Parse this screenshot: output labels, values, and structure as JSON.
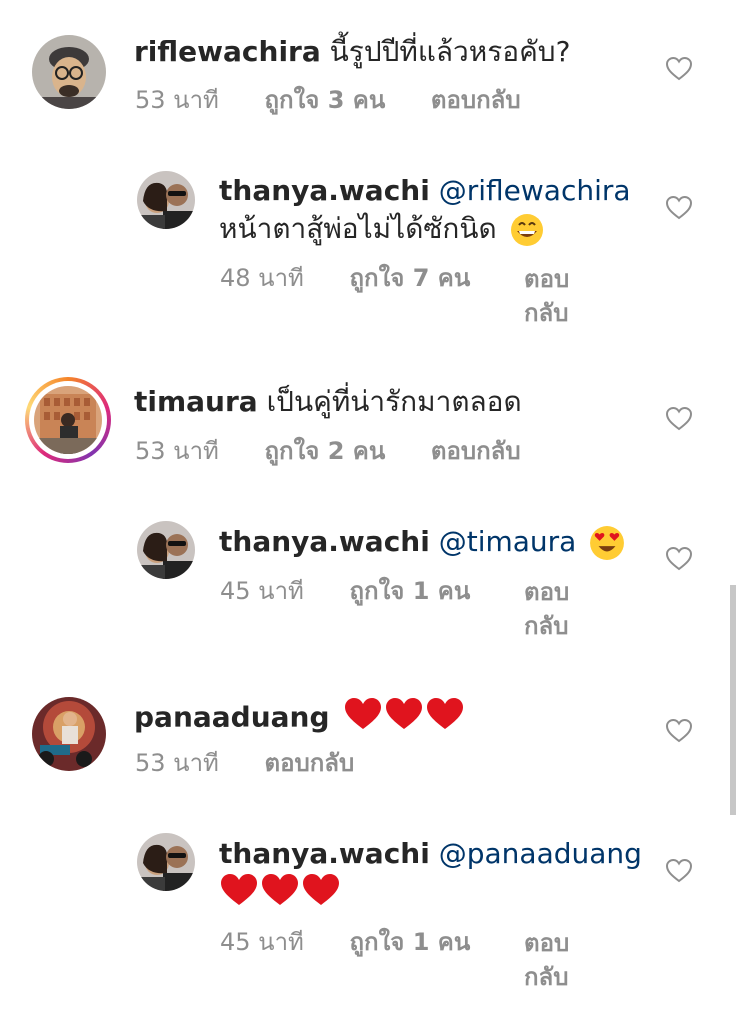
{
  "comments": [
    {
      "username": "riflewachira",
      "text": "นี้รูปปีที่แล้วหรอคับ?",
      "time": "53 นาที",
      "likes": "ถูกใจ 3 คน",
      "reply": "ตอบกลับ"
    },
    {
      "username": "thanya.wachi",
      "mention": "@riflewachira",
      "text": "หน้าตาสู้พ่อไม่ได้ซักนิด",
      "emoji": "grinning-face-emoji",
      "time": "48 นาที",
      "likes": "ถูกใจ 7 คน",
      "reply": "ตอบกลับ"
    },
    {
      "username": "timaura",
      "text": "เป็นคู่ที่น่ารักมาตลอด",
      "time": "53 นาที",
      "likes": "ถูกใจ 2 คน",
      "reply": "ตอบกลับ"
    },
    {
      "username": "thanya.wachi",
      "mention": "@timaura",
      "emoji": "heart-eyes-emoji",
      "time": "45 นาที",
      "likes": "ถูกใจ 1 คน",
      "reply": "ตอบกลับ"
    },
    {
      "username": "panaaduang",
      "emoji": "red-hearts-emoji",
      "time": "53 นาที",
      "reply": "ตอบกลับ"
    },
    {
      "username": "thanya.wachi",
      "mention": "@panaaduang",
      "emoji": "red-hearts-emoji",
      "time": "45 นาที",
      "likes": "ถูกใจ 1 คน",
      "reply": "ตอบกลับ"
    }
  ],
  "colors": {
    "text": "#262626",
    "meta": "#8e8e8e",
    "mention": "#003569",
    "heart_red": "#e0141e",
    "story_ring": "#dd2a7b"
  },
  "icons": {
    "like": "heart-outline-icon"
  }
}
